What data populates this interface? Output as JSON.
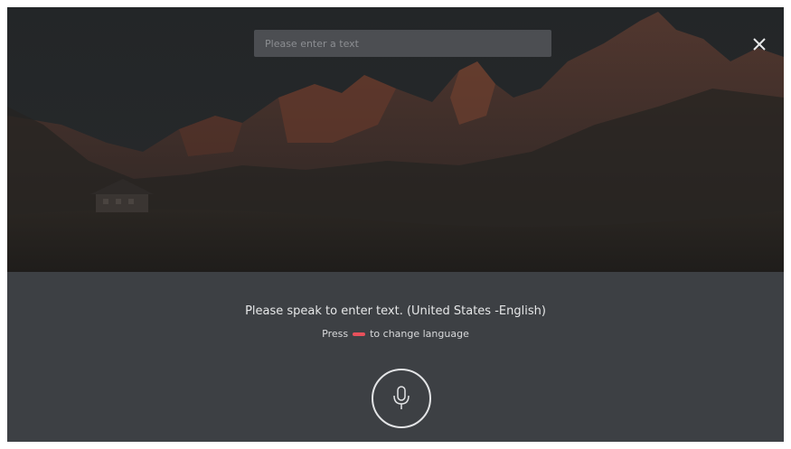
{
  "search": {
    "placeholder": "Please enter a text",
    "value": ""
  },
  "voice": {
    "prompt": "Please speak to enter text. (United States -English)",
    "hint_prefix": "Press",
    "hint_suffix": "to change language",
    "key_color": "#e8505b"
  },
  "icons": {
    "close": "close-icon",
    "mic": "microphone-icon",
    "red_key": "red-button-key"
  },
  "colors": {
    "panel": "#3d4044",
    "overlay": "#1c1d1f",
    "text": "#e6e7e8"
  }
}
